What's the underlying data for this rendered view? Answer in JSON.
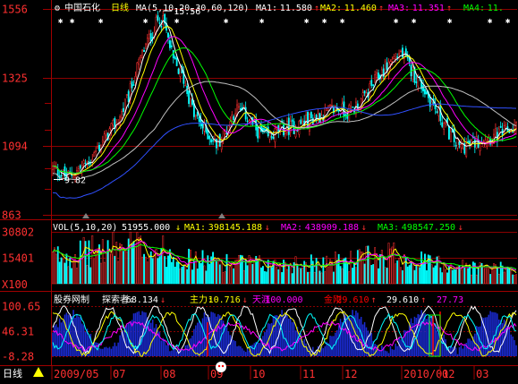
{
  "stock": {
    "name": "中国石化",
    "period": "日线"
  },
  "main_header": {
    "ma_params": "MA(5,10,20,30,60,120)",
    "ma_values": [
      {
        "label": "MA1:",
        "value": "11.580",
        "arrow": "↑",
        "color": "#ffffff"
      },
      {
        "label": "MA2:",
        "value": "11.460",
        "arrow": "↑",
        "color": "#ffff00"
      },
      {
        "label": "MA3:",
        "value": "11.351",
        "arrow": "↑",
        "color": "#ff00ff"
      },
      {
        "label": "MA4:",
        "value": "11.",
        "arrow": "",
        "color": "#00ff00"
      }
    ]
  },
  "price_axis_labels": [
    "1556",
    "1325",
    "1094",
    "863"
  ],
  "price_annotations": {
    "high": "15.56",
    "low": "9.82"
  },
  "vol_header": {
    "label": "VOL(5,10,20)",
    "value": "51955.000",
    "items": [
      {
        "label": "MA1:",
        "value": "398145.188",
        "arrow": "↓",
        "color": "#ffff00"
      },
      {
        "label": "MA2:",
        "value": "438909.188",
        "arrow": "↓",
        "color": "#ff00ff"
      },
      {
        "label": "MA3:",
        "value": "498547.250",
        "arrow": "↓",
        "color": "#00ff00"
      }
    ]
  },
  "vol_axis_labels": [
    "30802",
    "15401",
    "X100"
  ],
  "ind_header": {
    "name": "股券网制",
    "items": [
      {
        "label": "探索者:",
        "value": "68.134",
        "arrow": "↓",
        "color": "#ffffff"
      },
      {
        "label": "主力:",
        "value": "10.716",
        "arrow": "↓",
        "color": "#ffff00"
      },
      {
        "label": "天涯",
        "value": "100.000",
        "arrow": "",
        "color": "#ff00ff"
      },
      {
        "label": "金刚",
        "value": "29.610",
        "arrow": "↑",
        "color": "#ff0000"
      },
      {
        "label": "",
        "value": "29.610",
        "arrow": "↑",
        "color": "#ffffff"
      },
      {
        "label": "",
        "value": "27.73",
        "arrow": "",
        "color": "#ff00ff"
      }
    ]
  },
  "ind_axis_labels": [
    "100.65",
    "46.31",
    "-8.28"
  ],
  "time_axis": {
    "period_button": "日线",
    "labels": [
      "2009/05",
      "07",
      "08",
      "09",
      "10",
      "11",
      "12",
      "2010/01",
      "02",
      "03"
    ]
  },
  "colors": {
    "up": "#ff3030",
    "down": "#00ffff",
    "ma1": "#ffffff",
    "ma2": "#ffff00",
    "ma3": "#ff00ff",
    "ma4": "#00ff00",
    "ma5": "#c0c0c0",
    "ma6": "#3050ff",
    "grid": "#8b0000",
    "axis": "#a00000"
  },
  "chart_data": {
    "type": "line",
    "title": "中国石化 日线",
    "price_range": [
      8.63,
      15.56
    ],
    "price_ticks": [
      15.56,
      13.25,
      10.94,
      8.63
    ],
    "price_high": 15.56,
    "price_low": 9.82,
    "price_anchors": [
      [
        0,
        10.2
      ],
      [
        8,
        9.9
      ],
      [
        14,
        10.1
      ],
      [
        22,
        10.5
      ],
      [
        30,
        11.2
      ],
      [
        38,
        11.8
      ],
      [
        44,
        12.6
      ],
      [
        48,
        13.4
      ],
      [
        53,
        14.2
      ],
      [
        58,
        14.8
      ],
      [
        62,
        15.3
      ],
      [
        65,
        15.0
      ],
      [
        70,
        13.8
      ],
      [
        76,
        13.2
      ],
      [
        82,
        12.0
      ],
      [
        88,
        11.5
      ],
      [
        95,
        11.0
      ],
      [
        100,
        11.4
      ],
      [
        106,
        12.2
      ],
      [
        112,
        12.0
      ],
      [
        118,
        11.5
      ],
      [
        125,
        11.2
      ],
      [
        132,
        11.5
      ],
      [
        140,
        11.6
      ],
      [
        148,
        11.8
      ],
      [
        156,
        12.0
      ],
      [
        164,
        12.2
      ],
      [
        172,
        12.1
      ],
      [
        180,
        12.5
      ],
      [
        188,
        13.2
      ],
      [
        196,
        13.8
      ],
      [
        202,
        14.1
      ],
      [
        208,
        13.5
      ],
      [
        214,
        13.0
      ],
      [
        220,
        12.4
      ],
      [
        226,
        11.8
      ],
      [
        232,
        11.2
      ],
      [
        236,
        10.9
      ],
      [
        242,
        11.0
      ],
      [
        250,
        11.2
      ],
      [
        258,
        11.3
      ],
      [
        266,
        11.5
      ],
      [
        270,
        11.6
      ]
    ],
    "vol_range": [
      0,
      30802
    ],
    "vol_ticks": [
      30802,
      15401
    ],
    "vol_anchors": [
      [
        0,
        16000
      ],
      [
        15,
        18000
      ],
      [
        30,
        20000
      ],
      [
        45,
        22000
      ],
      [
        55,
        21000
      ],
      [
        65,
        19000
      ],
      [
        80,
        14000
      ],
      [
        95,
        13000
      ],
      [
        110,
        12000
      ],
      [
        125,
        11000
      ],
      [
        140,
        12000
      ],
      [
        155,
        12500
      ],
      [
        170,
        13000
      ],
      [
        185,
        16000
      ],
      [
        195,
        18000
      ],
      [
        205,
        15000
      ],
      [
        220,
        12000
      ],
      [
        240,
        10000
      ],
      [
        255,
        9000
      ],
      [
        270,
        8000
      ]
    ],
    "ind_range": [
      -8.28,
      100.65
    ],
    "ind_ticks": [
      100.65,
      46.31,
      -8.28
    ],
    "n_bars": 270,
    "ma_periods": [
      5,
      10,
      20,
      30,
      60,
      120
    ]
  }
}
